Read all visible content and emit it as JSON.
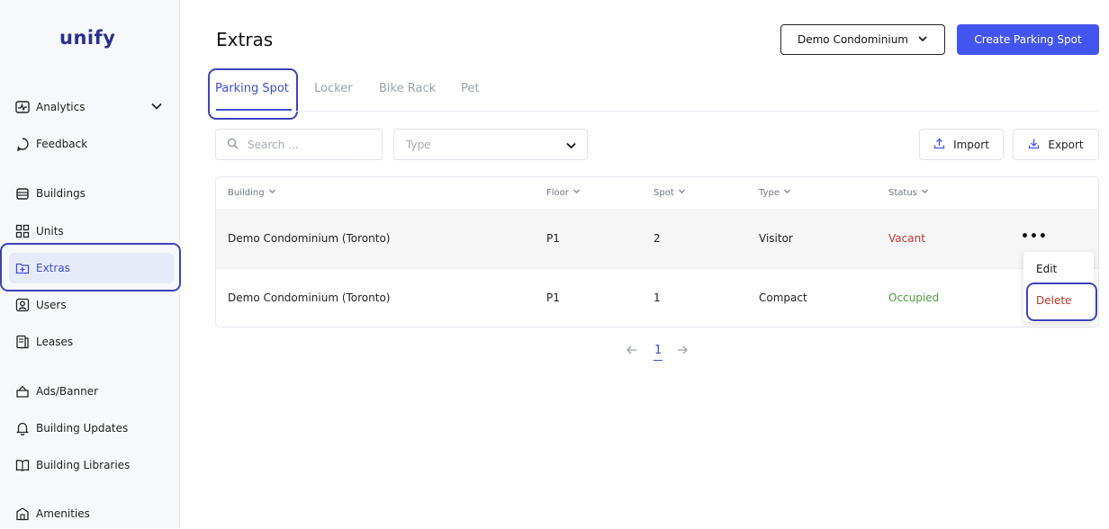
{
  "sidebar": {
    "logo": "unify",
    "items": [
      {
        "label": "Analytics",
        "icon": "analytics-icon"
      },
      {
        "label": "Feedback",
        "icon": "feedback-icon"
      },
      {
        "label": "Buildings",
        "icon": "buildings-icon"
      },
      {
        "label": "Units",
        "icon": "units-icon"
      },
      {
        "label": "Extras",
        "icon": "extras-icon",
        "active": true
      },
      {
        "label": "Users",
        "icon": "users-icon"
      },
      {
        "label": "Leases",
        "icon": "leases-icon"
      },
      {
        "label": "Ads/Banner",
        "icon": "ads-icon"
      },
      {
        "label": "Building Updates",
        "icon": "bell-icon"
      },
      {
        "label": "Building Libraries",
        "icon": "book-icon"
      },
      {
        "label": "Amenities",
        "icon": "amenities-icon"
      }
    ]
  },
  "header": {
    "title": "Extras",
    "building_select": "Demo Condominium",
    "create_button": "Create Parking Spot"
  },
  "tabs": [
    {
      "label": "Parking Spot",
      "active": true
    },
    {
      "label": "Locker"
    },
    {
      "label": "Bike Rack"
    },
    {
      "label": "Pet"
    }
  ],
  "filters": {
    "search_placeholder": "Search ...",
    "type_placeholder": "Type",
    "import_label": "Import",
    "export_label": "Export"
  },
  "table": {
    "columns": [
      "Building",
      "Floor",
      "Spot",
      "Type",
      "Status"
    ],
    "rows": [
      {
        "building": "Demo Condominium (Toronto)",
        "floor": "P1",
        "spot": "2",
        "type": "Visitor",
        "status": "Vacant"
      },
      {
        "building": "Demo Condominium (Toronto)",
        "floor": "P1",
        "spot": "1",
        "type": "Compact",
        "status": "Occupied"
      }
    ]
  },
  "row_menu": {
    "edit": "Edit",
    "delete": "Delete"
  },
  "pagination": {
    "current_page": "1"
  },
  "colors": {
    "accent": "#4355ef",
    "highlight_border": "#3d43bd",
    "vacant": "#c0342b",
    "occupied": "#4c9a3a",
    "logo": "#28318f"
  }
}
